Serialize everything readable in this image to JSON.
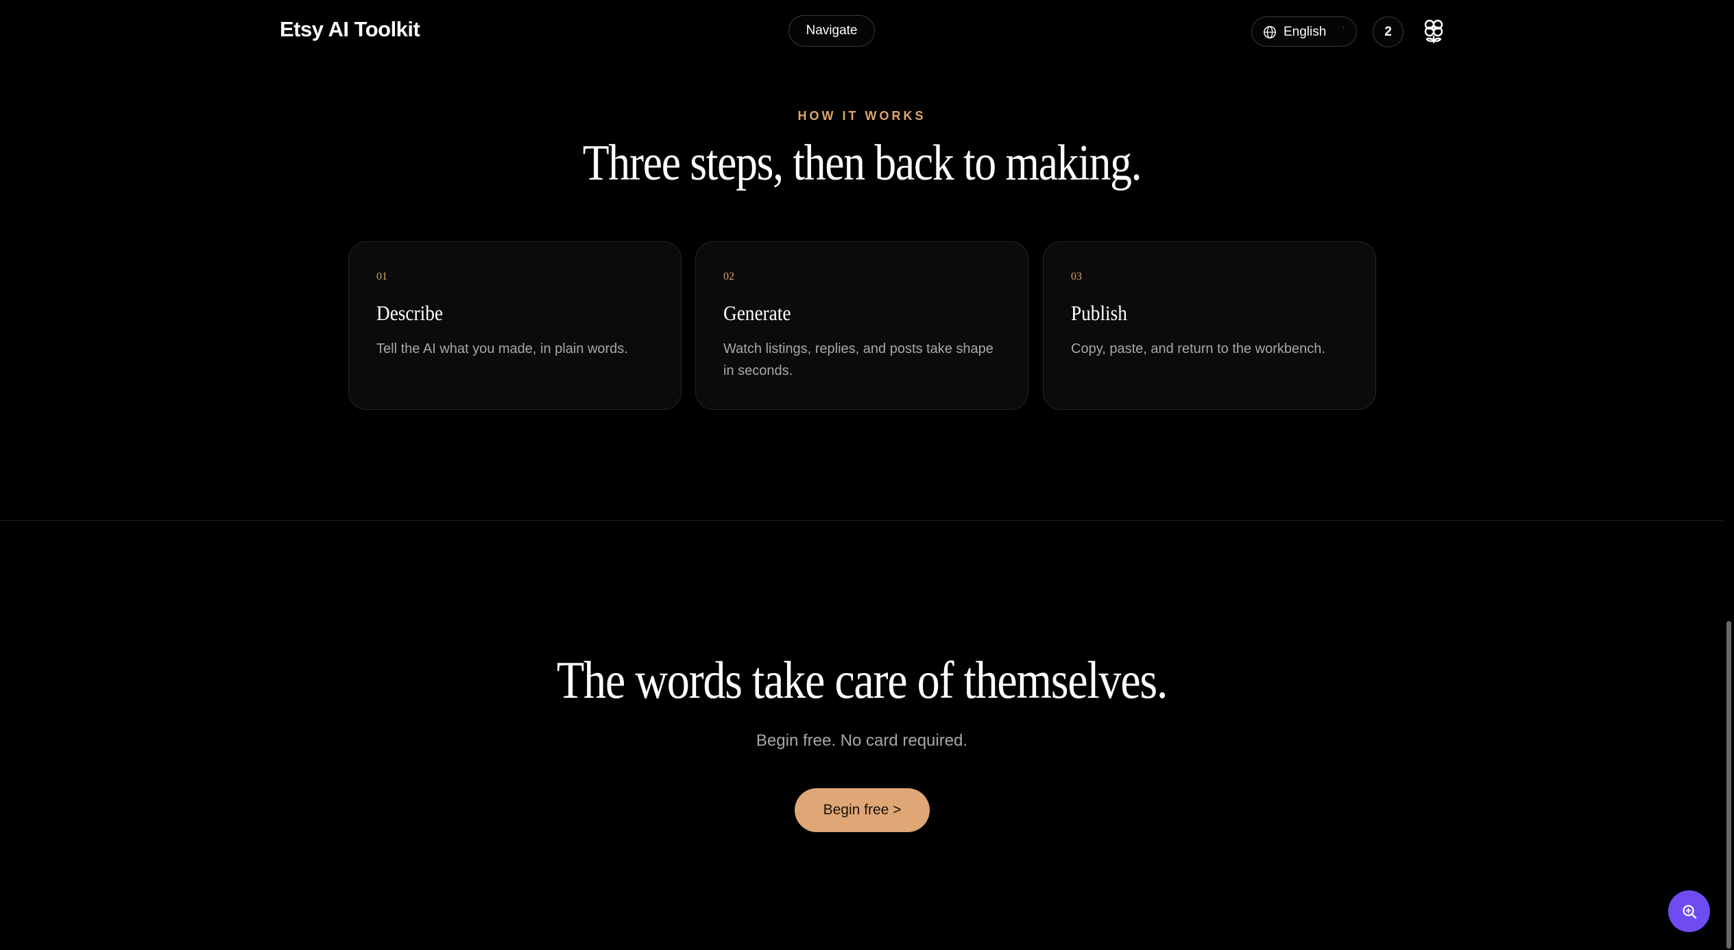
{
  "header": {
    "brand": "Etsy AI Toolkit",
    "navigate_label": "Navigate",
    "language": {
      "selected": "English",
      "icon": "globe-icon",
      "caret_icon": "chevron-down-icon"
    },
    "notification_count": "2",
    "profile_icon": "flower-icon"
  },
  "how_it_works": {
    "eyebrow": "HOW IT WORKS",
    "title": "Three steps, then back to making.",
    "steps": [
      {
        "number": "01",
        "title": "Describe",
        "description": "Tell the AI what you made, in plain words."
      },
      {
        "number": "02",
        "title": "Generate",
        "description": "Watch listings, replies, and posts take shape in seconds."
      },
      {
        "number": "03",
        "title": "Publish",
        "description": "Copy, paste, and return to the workbench."
      }
    ]
  },
  "cta": {
    "title": "The words take care of themselves.",
    "subtitle": "Begin free. No card required.",
    "button_label": "Begin free >"
  },
  "fab": {
    "icon": "search-zoom-icon"
  },
  "colors": {
    "background": "#000000",
    "accent": "#e0a56c",
    "cta_button": "#dea775",
    "fab": "#6f4cf2",
    "card_background": "#0b0b0b",
    "card_border": "#262626",
    "muted_text": "#a8a8a8"
  }
}
